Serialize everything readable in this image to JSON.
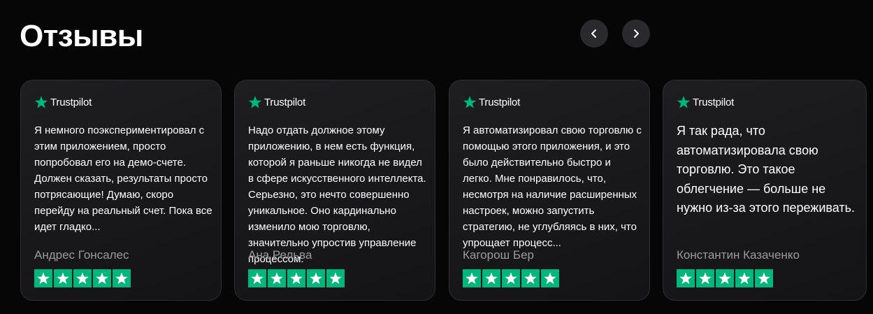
{
  "section": {
    "title": "Отзывы",
    "prev_icon": "chevron-left-icon",
    "next_icon": "chevron-right-icon"
  },
  "brand": {
    "name": "Trustpilot",
    "star_color": "#00b67a"
  },
  "reviews": [
    {
      "text": "Я немного поэкспериментировал с этим приложением, просто попробовал его на демо-счете. Должен сказать, результаты просто потрясающие! Думаю, скоро перейду на реальный счет. Пока все идет гладко...",
      "author": "Андрес Гонсалес",
      "rating": 5
    },
    {
      "text": "Надо отдать должное этому приложению, в нем есть функция, которой я раньше никогда не видел в сфере искусственного интеллекта. Серьезно, это нечто совершенно уникальное. Оно кардинально изменило мою торговлю, значительно упростив управление процессом.",
      "author": "Ана Рельва",
      "rating": 5
    },
    {
      "text": "Я автоматизировал свою торговлю с помощью этого приложения, и это было действительно быстро и легко. Мне понравилось, что, несмотря на наличие расширенных настроек, можно запустить стратегию, не углубляясь в них, что упрощает процесс...",
      "author": "Кагорош Бер",
      "rating": 5
    },
    {
      "text": "Я так рада, что автоматизировала свою торговлю. Это такое облегчение — больше не нужно из-за этого переживать.",
      "author": "Константин Казаченко",
      "rating": 5
    }
  ]
}
